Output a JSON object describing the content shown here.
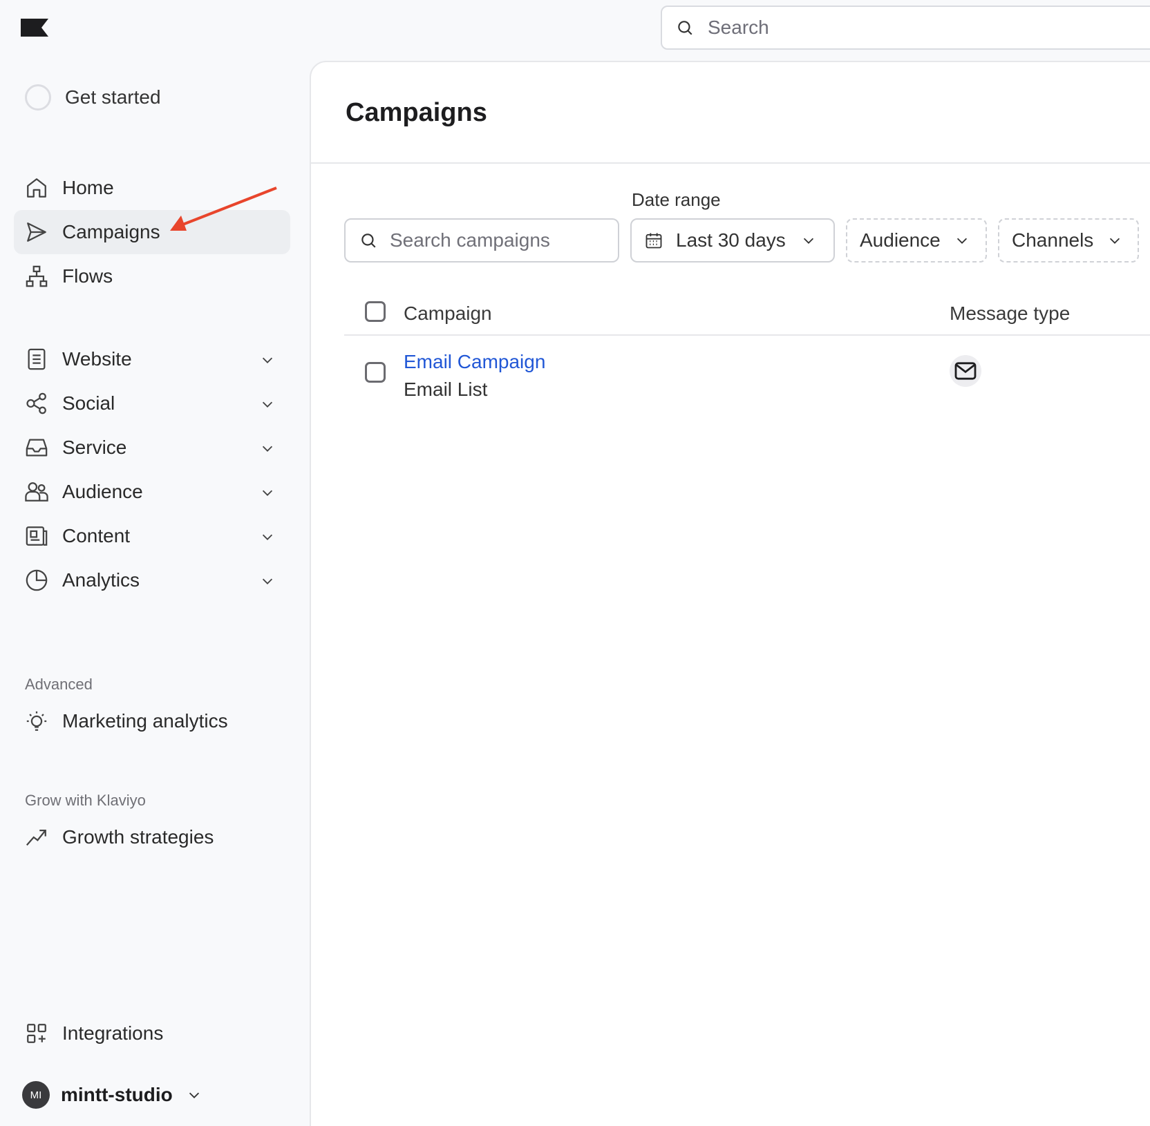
{
  "header": {
    "logo": "klaviyo-flag-logo",
    "search_placeholder": "Search"
  },
  "sidebar": {
    "get_started": "Get started",
    "primary": [
      {
        "label": "Home",
        "icon": "home-icon"
      },
      {
        "label": "Campaigns",
        "icon": "send-icon",
        "active": true
      },
      {
        "label": "Flows",
        "icon": "flows-icon"
      }
    ],
    "groups": [
      {
        "label": "Website",
        "icon": "document-icon"
      },
      {
        "label": "Social",
        "icon": "share-icon"
      },
      {
        "label": "Service",
        "icon": "inbox-icon"
      },
      {
        "label": "Audience",
        "icon": "users-icon"
      },
      {
        "label": "Content",
        "icon": "content-icon"
      },
      {
        "label": "Analytics",
        "icon": "pie-chart-icon"
      }
    ],
    "advanced": {
      "heading": "Advanced",
      "item": "Marketing analytics"
    },
    "grow": {
      "heading": "Grow with Klaviyo",
      "item": "Growth strategies"
    },
    "integrations": "Integrations",
    "account": {
      "initials": "MI",
      "name": "mintt-studio"
    }
  },
  "main": {
    "title": "Campaigns",
    "filters": {
      "search_placeholder": "Search campaigns",
      "date_range_label": "Date range",
      "date_range_value": "Last 30 days",
      "audience": "Audience",
      "channels": "Channels"
    },
    "table": {
      "columns": [
        "Campaign",
        "Message type"
      ],
      "rows": [
        {
          "name": "Email Campaign",
          "subtitle": "Email List",
          "message_type_icon": "envelope-icon"
        }
      ]
    }
  },
  "annotation": {
    "arrow_color": "#e8452c"
  },
  "colors": {
    "link": "#2157d6",
    "active_bg": "#eceef1"
  }
}
